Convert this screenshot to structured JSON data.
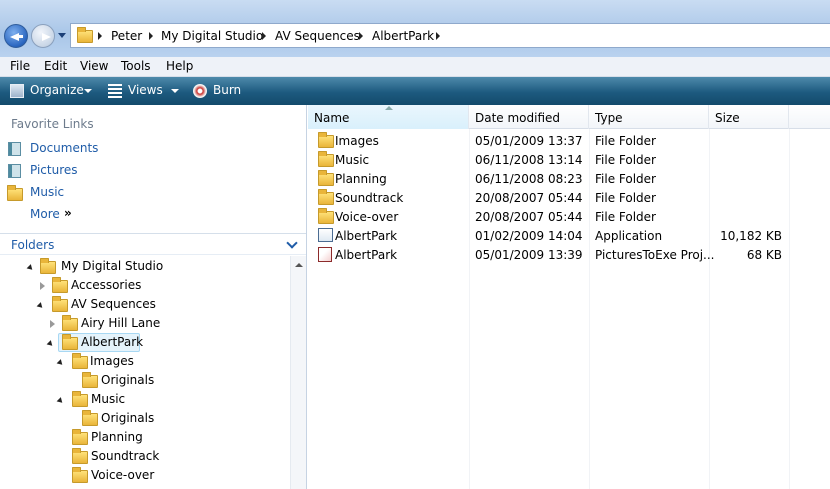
{
  "address": {
    "crumbs": [
      "Peter",
      "My Digital Studio",
      "AV Sequences",
      "AlbertPark"
    ]
  },
  "menu": [
    "File",
    "Edit",
    "View",
    "Tools",
    "Help"
  ],
  "toolbar": {
    "organize": "Organize",
    "views": "Views",
    "burn": "Burn"
  },
  "nav": {
    "favorites_header": "Favorite Links",
    "links": [
      "Documents",
      "Pictures",
      "Music"
    ],
    "more": "More",
    "more_glyph": "»",
    "folders_header": "Folders"
  },
  "tree": [
    {
      "label": "My Digital Studio"
    },
    {
      "label": "Accessories"
    },
    {
      "label": "AV Sequences"
    },
    {
      "label": "Airy Hill Lane"
    },
    {
      "label": "AlbertPark",
      "selected": true
    },
    {
      "label": "Images"
    },
    {
      "label": "Originals"
    },
    {
      "label": "Music"
    },
    {
      "label": "Originals"
    },
    {
      "label": "Planning"
    },
    {
      "label": "Soundtrack"
    },
    {
      "label": "Voice-over"
    }
  ],
  "columns": {
    "name": "Name",
    "date": "Date modified",
    "type": "Type",
    "size": "Size"
  },
  "files": [
    {
      "name": "Images",
      "date": "05/01/2009 13:37",
      "type": "File Folder",
      "size": "",
      "icon": "folder-icon"
    },
    {
      "name": "Music",
      "date": "06/11/2008 13:14",
      "type": "File Folder",
      "size": "",
      "icon": "folder-icon"
    },
    {
      "name": "Planning",
      "date": "06/11/2008 08:23",
      "type": "File Folder",
      "size": "",
      "icon": "folder-icon"
    },
    {
      "name": "Soundtrack",
      "date": "20/08/2007 05:44",
      "type": "File Folder",
      "size": "",
      "icon": "folder-icon"
    },
    {
      "name": "Voice-over",
      "date": "20/08/2007 05:44",
      "type": "File Folder",
      "size": "",
      "icon": "folder-icon"
    },
    {
      "name": "AlbertPark",
      "date": "01/02/2009 14:04",
      "type": "Application",
      "size": "10,182 KB",
      "icon": "application-icon"
    },
    {
      "name": "AlbertPark",
      "date": "05/01/2009 13:39",
      "type": "PicturesToExe Proj...",
      "size": "68 KB",
      "icon": "project-file-icon"
    }
  ],
  "colors": {
    "toolbar": "#1d5a7f",
    "link": "#1f5ca8",
    "selection": "#cce8ff"
  }
}
